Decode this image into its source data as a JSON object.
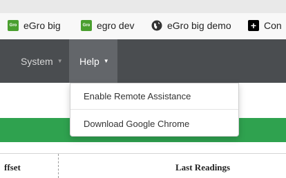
{
  "bookmarks": [
    {
      "label": "eGro big",
      "icon": "egro-favicon"
    },
    {
      "label": "egro dev",
      "icon": "egro-favicon"
    },
    {
      "label": "eGro big demo",
      "icon": "globe-icon"
    },
    {
      "label": "Con",
      "icon": "plus-icon"
    }
  ],
  "favicon_text": "Gro",
  "nav": {
    "system": "System",
    "help": "Help",
    "caret": "▼"
  },
  "help_menu": {
    "items": [
      "Enable Remote Assistance",
      "Download Google Chrome"
    ]
  },
  "table": {
    "columns": [
      "ffset",
      "Last Readings"
    ]
  },
  "colors": {
    "navbar": "#4a4d50",
    "nav_active": "#63666a",
    "green_band": "#2fa24f",
    "favicon_green": "#4a9f2f"
  }
}
